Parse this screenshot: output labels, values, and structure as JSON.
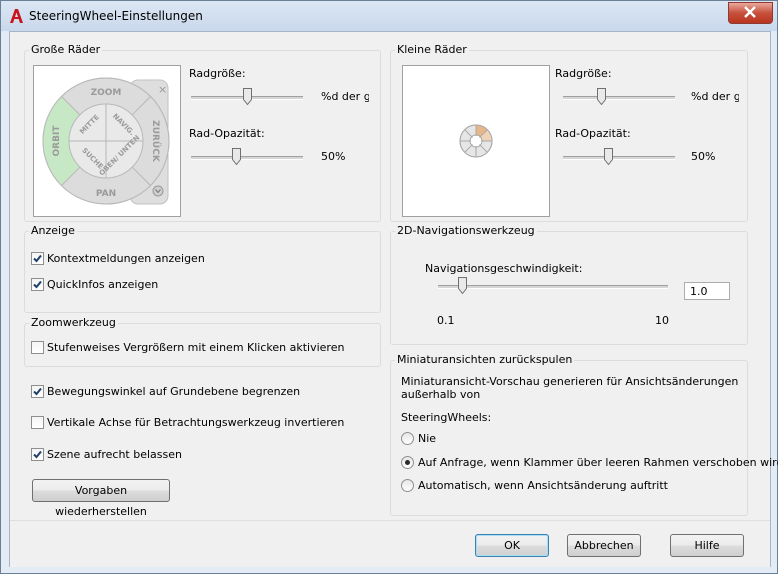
{
  "window": {
    "title": "SteeringWheel-Einstellungen"
  },
  "large_wheels": {
    "group_title": "Große Räder",
    "wheel_labels": {
      "zoom": "ZOOM",
      "orbit": "ORBIT",
      "back": "ZURÜCK",
      "pan": "PAN",
      "center": "MITTE",
      "walk": "NAVIG.",
      "look": "SUCHE",
      "updown": "OBEN/ UNTEN"
    },
    "size_label": "Radgröße:",
    "size_value": "%d der ge",
    "size_level": 0.5,
    "opacity_label": "Rad-Opazität:",
    "opacity_value": "50%",
    "opacity_level": 0.4
  },
  "small_wheels": {
    "group_title": "Kleine Räder",
    "size_label": "Radgröße:",
    "size_value": "%d der ge",
    "size_level": 0.33,
    "opacity_label": "Rad-Opazität:",
    "opacity_value": "50%",
    "opacity_level": 0.4
  },
  "display": {
    "group_title": "Anzeige",
    "context_messages": {
      "label": "Kontextmeldungen anzeigen",
      "checked": true
    },
    "tooltips": {
      "label": "QuickInfos anzeigen",
      "checked": true
    }
  },
  "zoom_tool": {
    "group_title": "Zoomwerkzeug",
    "incremental": {
      "label": "Stufenweises Vergrößern mit einem Klicken aktivieren",
      "checked": false
    }
  },
  "options": {
    "constrain_walk": {
      "label": "Bewegungswinkel auf Grundebene begrenzen",
      "checked": true
    },
    "invert_axis": {
      "label": "Vertikale Achse für Betrachtungswerkzeug invertieren",
      "checked": false
    },
    "keep_upright": {
      "label": "Szene aufrecht belassen",
      "checked": true
    },
    "restore_defaults_label": "Vorgaben wiederherstellen"
  },
  "nav2d": {
    "group_title": "2D-Navigationswerkzeug",
    "speed_label": "Navigationsgeschwindigkeit:",
    "speed_value": "1.0",
    "speed_level": 0.09,
    "min_label": "0.1",
    "max_label": "10"
  },
  "rewind": {
    "group_title": "Miniaturansichten zurückspulen",
    "description_line1": "Miniaturansicht-Vorschau generieren für Ansichtsänderungen",
    "description_line2": "außerhalb von",
    "steering_label": "SteeringWheels:",
    "options": [
      {
        "label": "Nie",
        "selected": false
      },
      {
        "label": "Auf Anfrage, wenn Klammer über leeren Rahmen verschoben wird",
        "selected": true
      },
      {
        "label": "Automatisch, wenn Ansichtsänderung auftritt",
        "selected": false
      }
    ]
  },
  "buttons": {
    "ok": "OK",
    "cancel": "Abbrechen",
    "help": "Hilfe"
  },
  "colors": {
    "accent_orbit": "#c7e8c4",
    "wheel_gray": "#d9d9d9",
    "title_bar": "#d2dff0",
    "small_wheel_highlight": "#e8b68a"
  }
}
